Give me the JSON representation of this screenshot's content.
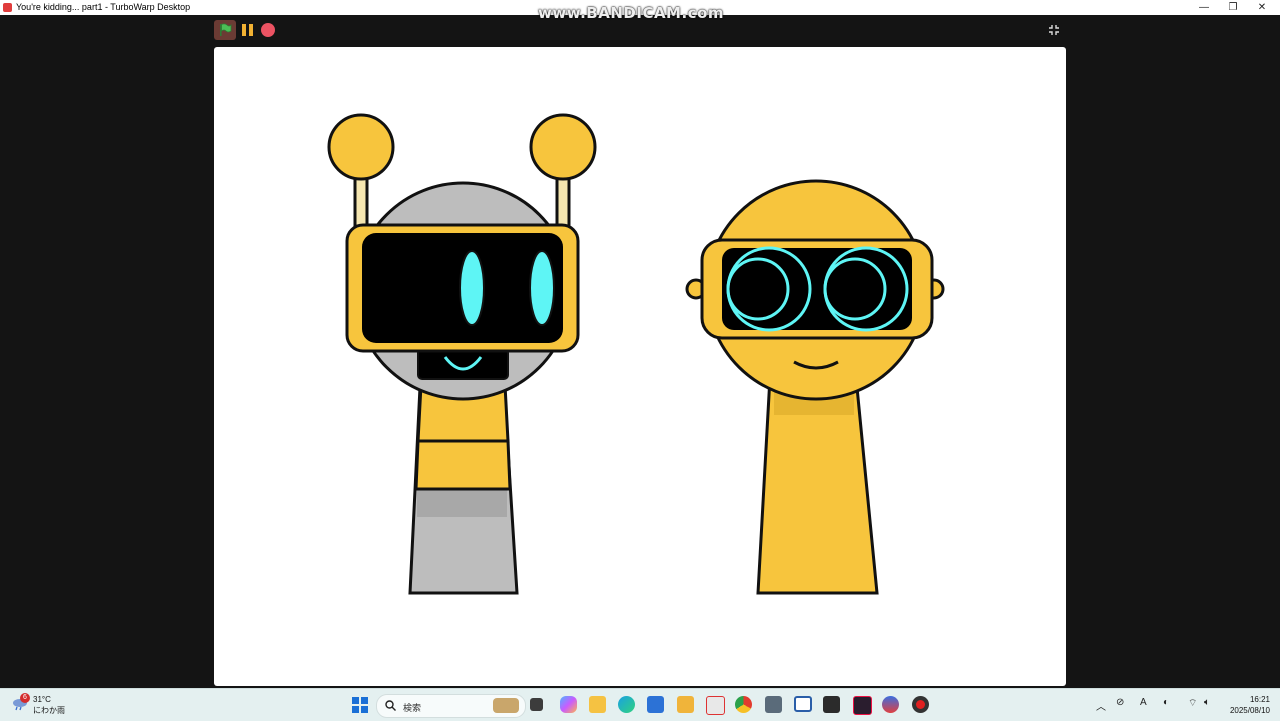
{
  "window": {
    "title": "You're kidding... part1 - TurboWarp Desktop",
    "minimize_icon": "minimize-icon",
    "maximize_icon": "restore-icon",
    "close_icon": "close-icon"
  },
  "watermark": "www.BANDICAM.com",
  "player": {
    "green_flag_icon": "green-flag-icon",
    "pause_icon": "pause-icon",
    "stop_icon": "stop-icon",
    "fullscreen_icon": "exit-fullscreen-icon",
    "colors": {
      "flag": "#4cbf56",
      "pause": "#f2b233",
      "stop": "#ec5363"
    }
  },
  "stage": {
    "background": "#ffffff",
    "sprites": [
      "robot-character",
      "yellow-goggle-character"
    ],
    "colors": {
      "yellow": "#f7c53d",
      "grey": "#bdbdbd",
      "cyan": "#5ef5f5",
      "outline": "#111111"
    }
  },
  "taskbar": {
    "weather": {
      "badge": "6",
      "temp": "31°C",
      "condition": "にわか雨"
    },
    "search_placeholder": "検索",
    "apps": [
      "windows-start",
      "search",
      "file-manager",
      "copilot",
      "file-explorer",
      "edge",
      "store",
      "notes",
      "turbowarp",
      "chrome",
      "calculator",
      "window",
      "audio-editor",
      "app-a",
      "headset",
      "bandicam"
    ],
    "clock": {
      "time": "16:21",
      "date": "2025/08/10"
    }
  }
}
